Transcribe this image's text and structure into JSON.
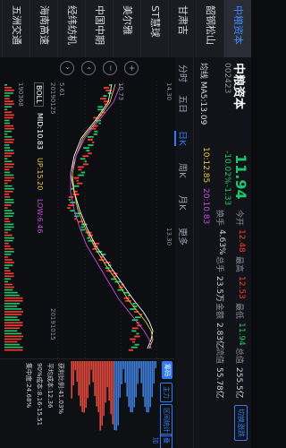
{
  "watchlist": [
    "中粮资本",
    "韶钢松山",
    "甘肃吉",
    "ST慧球",
    "美尔雅",
    "中国中期",
    "经纬纺机",
    "海南高速",
    "五洲交通"
  ],
  "stock": {
    "name": "中粮资本",
    "code": "002423",
    "price": "11.94",
    "change": "-1.33",
    "change_pct": "-10.02%",
    "kai_label": "今开",
    "kai": "12.48",
    "high_label": "最高",
    "high": "12.53",
    "low_label": "最低",
    "low": "11.94",
    "market_cap_label": "总值",
    "market_cap": "255.5亿",
    "turnover_label": "换手",
    "turnover": "4.63%",
    "shares_label": "总手",
    "shares": "23.5万",
    "amount_label": "金额",
    "amount": "2.83亿",
    "float_label": "流值",
    "float_cap": "55.78亿",
    "limit_up_label": "切换涨跌"
  },
  "tabs": [
    "分时",
    "五日",
    "日K",
    "周K",
    "月K",
    "更多"
  ],
  "ma_line": {
    "label": "均线 MA5:13.09",
    "ma10": "10:12.85",
    "ma20": "20:10.83"
  },
  "axis": {
    "top": "14.30",
    "mid": "10.73",
    "low": "5.61",
    "date_start": "20190125",
    "date_end": "20190111",
    "date_right": "20191015",
    "vol_label": "190368",
    "right_top": "13.30"
  },
  "indicator": {
    "label": "BOLL",
    "mid": "MID:10.83",
    "up": "UP:15.20",
    "low": "LOW:6.46"
  },
  "right_panel": {
    "chip_tabs": [
      "筹码",
      "主力",
      "区间统计",
      "叠加"
    ],
    "profit_ratio": "获利比例:41.03%",
    "avg_cost": "平均成本:12.36",
    "cost_90": "90%成本:8.16-15.51",
    "concentration": "集中度:24.68%",
    "buttons": [
      "画线",
      "上一个",
      "下一个"
    ]
  },
  "colors": {
    "up": "#ff3b30",
    "down": "#1ec76a",
    "accent": "#2f7cf6"
  }
}
